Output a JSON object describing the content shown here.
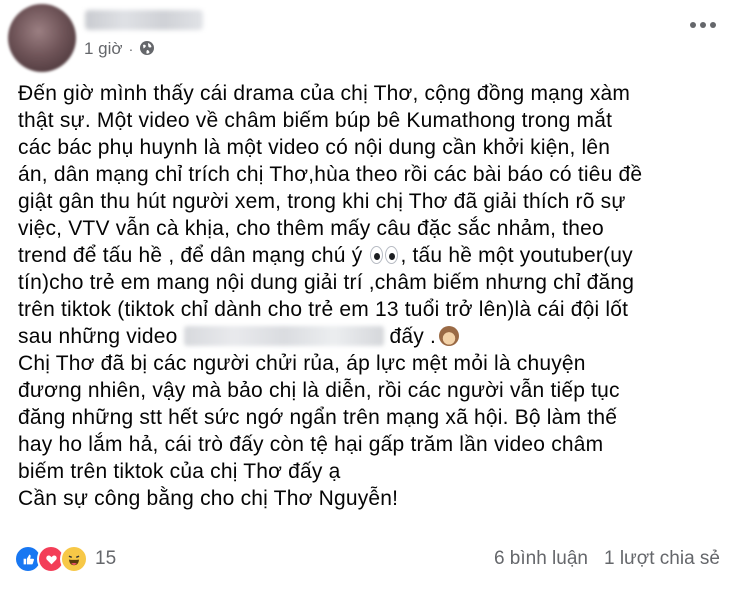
{
  "header": {
    "time": "1 giờ",
    "separator": "·",
    "privacy_icon": "globe-icon",
    "more_icon": "more-options-icon"
  },
  "post": {
    "lines": [
      "Đến giờ mình thấy cái drama của chị Thơ,  cộng đồng mạng xàm",
      "thật sự. Một video về châm biếm búp bê Kumathong trong mắt",
      "các bác phụ huynh là một video có nội dung cần khởi kiện,  lên",
      "án, dân mạng chỉ trích chị Thơ,hùa theo rồi các bài báo có tiêu đề",
      "giật gân thu hút người xem,  trong khi chị Thơ đã giải thích rõ sự",
      "việc, VTV vẫn cà khịa, cho thêm  mấy câu đặc sắc nhảm,  theo",
      "trend để tấu hề , để dân mạng chú ý",
      ", tấu hề một youtuber(uy",
      "tín)cho trẻ em mang nội dung giải trí ,châm biếm nhưng chỉ đăng",
      "trên tiktok (tiktok chỉ dành cho trẻ em 13 tuổi trở lên)là cái đội lốt",
      "sau những video",
      "đấy .",
      "Chị Thơ đã bị các người chửi rủa,  áp lực mệt mỏi là chuyện",
      "đương nhiên, vậy mà bảo chị là diễn, rồi các người vẫn tiếp tục",
      "đăng những stt hết sức ngớ ngẩn trên mạng xã hội. Bộ làm thế",
      "hay ho lắm hả, cái trò đấy còn tệ hại gấp trăm lần video châm",
      "biếm trên tiktok của chị Thơ đấy ạ",
      "Cần sự công bằng cho chị Thơ Nguyễn!"
    ]
  },
  "footer": {
    "reaction_icons": [
      "like-icon",
      "love-icon",
      "haha-icon"
    ],
    "reaction_count": "15",
    "comments": "6 bình luận",
    "shares": "1 lượt chia sẻ"
  },
  "colors": {
    "secondary_text": "#65676b",
    "like_blue": "#1877f2",
    "love_red": "#f33e58",
    "haha_yellow": "#f7c847"
  }
}
